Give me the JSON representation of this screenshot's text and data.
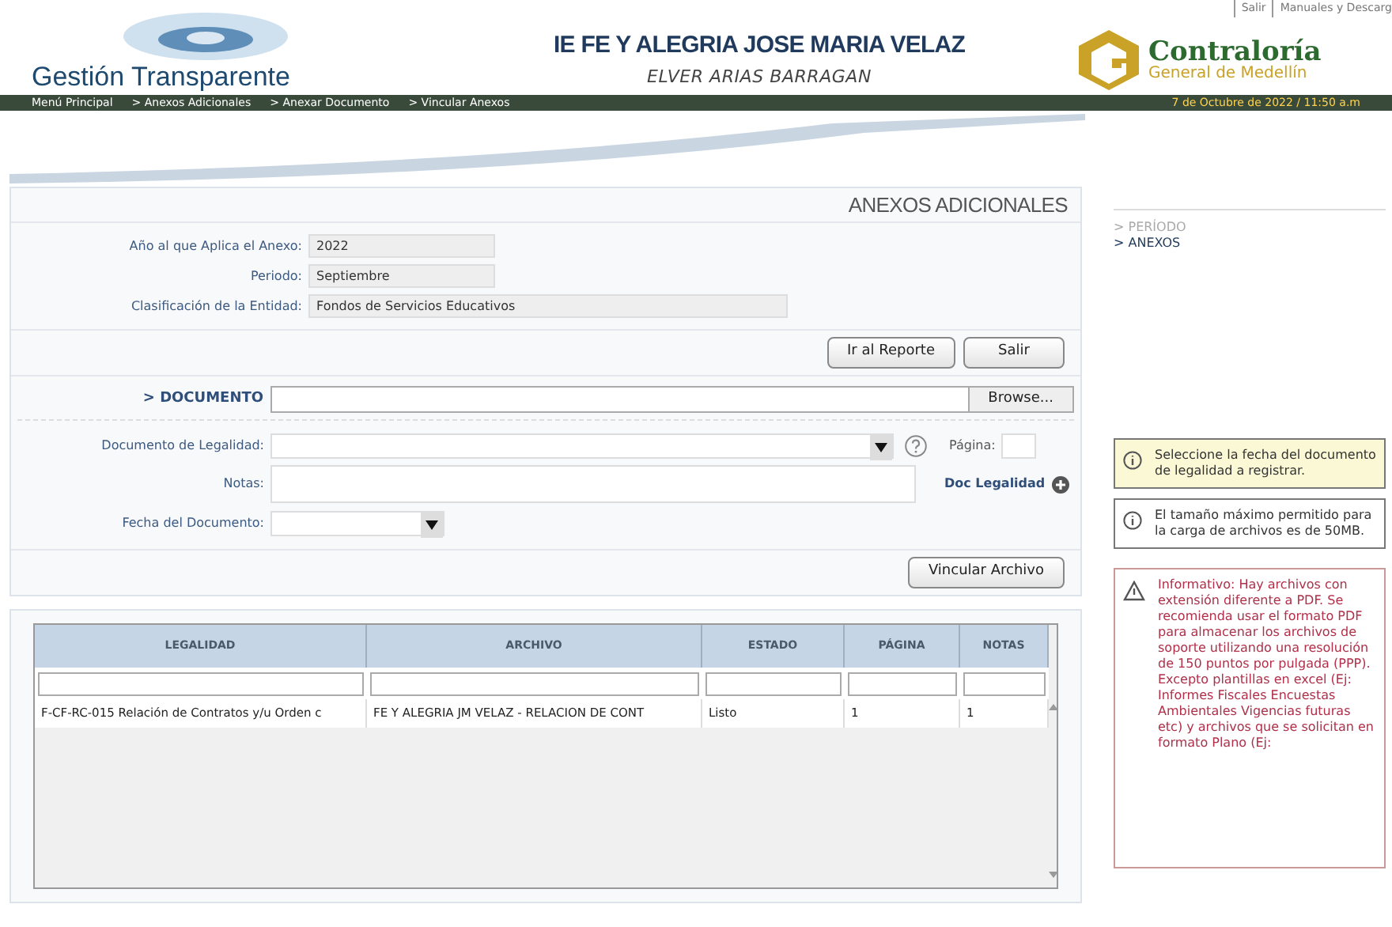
{
  "header": {
    "brand": "Gestión Transparente",
    "institution": "IE FE Y ALEGRIA JOSE MARIA VELAZ",
    "user": "ELVER ARIAS BARRAGAN",
    "top_links": [
      "Salir",
      "Manuales y Descarg"
    ],
    "logo_title": "Contraloría",
    "logo_subtitle": "General de Medellín"
  },
  "breadcrumb": [
    "Menú Principal",
    "> Anexos Adicionales",
    "> Anexar Documento",
    "> Vincular Anexos"
  ],
  "datetime": "7 de Octubre de 2022 / 11:50 a.m",
  "page_title": "ANEXOS ADICIONALES",
  "info_fields": [
    {
      "label": "Año al que Aplica el Anexo:",
      "value": "2022"
    },
    {
      "label": "Periodo:",
      "value": "Septiembre"
    },
    {
      "label": "Clasificación de la Entidad:",
      "value": "Fondos de Servicios Educativos"
    }
  ],
  "top_buttons": [
    "Ir al Reporte",
    "Salir"
  ],
  "document": {
    "label": "> DOCUMENTO",
    "browse": "Browse..."
  },
  "legalidad_label": "Documento de Legalidad:",
  "pagina_label": "Página:",
  "notas_label": "Notas:",
  "doc_legalidad_link": "Doc Legalidad",
  "fecha_label": "Fecha del Documento:",
  "link_button": "Vincular Archivo",
  "table": {
    "columns": [
      "LEGALIDAD",
      "ARCHIVO",
      "ESTADO",
      "PÁGINA",
      "NOTAS"
    ],
    "rows": [
      [
        "F-CF-RC-015 Relación de Contratos y/u Orden c",
        "FE Y ALEGRIA JM VELAZ - RELACION DE CONT",
        "Listo",
        "1",
        "1"
      ]
    ]
  },
  "sidebar": {
    "items": [
      {
        "label": "> PERÍODO",
        "selected": false
      },
      {
        "label": "> ANEXOS",
        "selected": true
      }
    ]
  },
  "notices": [
    {
      "kind": "hint",
      "text": "Seleccione la fecha del documento de legalidad a registrar."
    },
    {
      "kind": "info",
      "text": "El tamaño máximo permitido para la carga de archivos es de 50MB."
    },
    {
      "kind": "warning",
      "text": "Informativo: Hay archivos con extensión diferente a PDF. Se recomienda usar el formato PDF para almacenar los archivos de soporte utilizando una resolución de 150 puntos por pulgada (PPP). Excepto plantillas en excel (Ej: Informes Fiscales Encuestas Ambientales Vigencias futuras etc) y archivos que se solicitan en formato Plano (Ej:"
    }
  ]
}
